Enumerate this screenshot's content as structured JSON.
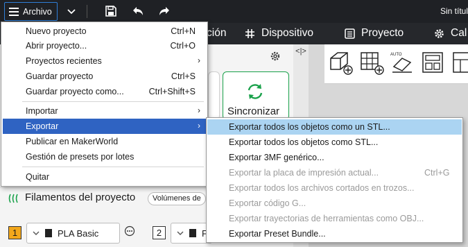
{
  "titlebar": {
    "file_menu_label": "Archivo",
    "doc_title": "Sin título"
  },
  "nav": {
    "tabs": [
      {
        "label": "ción",
        "icon": "none"
      },
      {
        "label": "Dispositivo",
        "icon": "device-icon"
      },
      {
        "label": "Proyecto",
        "icon": "project-icon"
      },
      {
        "label": "Cal",
        "icon": "gear-icon"
      }
    ]
  },
  "panel": {
    "sync_label": "Sincronizar",
    "filaments_title": "Filamentos del proyecto",
    "volumes_chip": "Volúmenes de",
    "split_label": "<|>"
  },
  "filaments": [
    {
      "slot": "1",
      "name": "PLA Basic",
      "slot_color": "#f2a71b"
    },
    {
      "slot": "2",
      "name": "F",
      "slot_color": "#ffffff"
    }
  ],
  "file_menu": {
    "items": [
      {
        "label": "Nuevo proyecto",
        "shortcut": "Ctrl+N",
        "submenu": false
      },
      {
        "label": "Abrir proyecto...",
        "shortcut": "Ctrl+O",
        "submenu": false
      },
      {
        "label": "Proyectos recientes",
        "shortcut": "",
        "submenu": true
      },
      {
        "label": "Guardar proyecto",
        "shortcut": "Ctrl+S",
        "submenu": false
      },
      {
        "label": "Guardar proyecto como...",
        "shortcut": "Ctrl+Shift+S",
        "submenu": false
      },
      {
        "label": "Importar",
        "shortcut": "",
        "submenu": true
      },
      {
        "label": "Exportar",
        "shortcut": "",
        "submenu": true,
        "active": true
      },
      {
        "label": "Publicar en MakerWorld",
        "shortcut": "",
        "submenu": false
      },
      {
        "label": "Gestión de presets por lotes",
        "shortcut": "",
        "submenu": false
      },
      {
        "label": "Quitar",
        "shortcut": "",
        "submenu": false
      }
    ],
    "arrow_glyph": "›"
  },
  "export_submenu": {
    "items": [
      {
        "label": "Exportar todos los objetos como un STL...",
        "shortcut": "",
        "enabled": true,
        "highlighted": true
      },
      {
        "label": "Exportar todos los objetos como STL...",
        "shortcut": "",
        "enabled": true
      },
      {
        "label": "Exportar 3MF genérico...",
        "shortcut": "",
        "enabled": true
      },
      {
        "label": "Exportar la placa de impresión actual...",
        "shortcut": "Ctrl+G",
        "enabled": false
      },
      {
        "label": "Exportar todos los archivos cortados en trozos...",
        "shortcut": "",
        "enabled": false
      },
      {
        "label": "Exportar código G...",
        "shortcut": "",
        "enabled": false
      },
      {
        "label": "Exportar trayectorias de herramientas como OBJ...",
        "shortcut": "",
        "enabled": false
      },
      {
        "label": "Exportar Preset Bundle...",
        "shortcut": "",
        "enabled": true
      }
    ]
  },
  "colors": {
    "titlebar_bg": "#1f2125",
    "accent_green": "#19a14a",
    "menu_active": "#2f63c2",
    "submenu_highlight": "#abd4f2",
    "disabled_text": "#9a9a9a"
  }
}
